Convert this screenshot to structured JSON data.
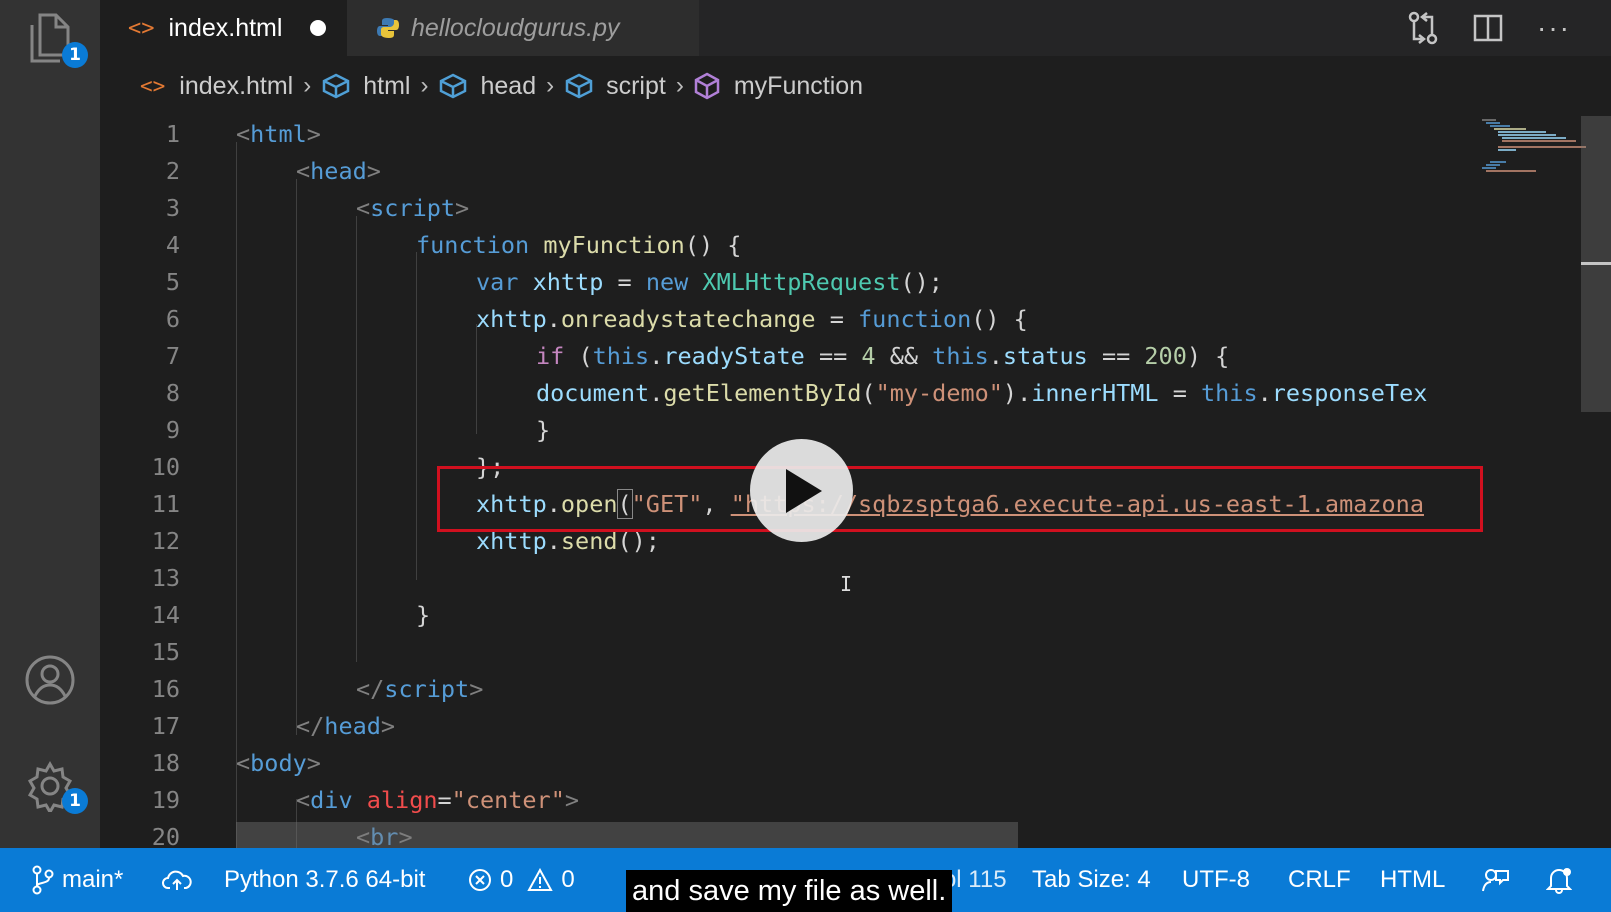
{
  "tabs": [
    {
      "label": "index.html",
      "active": true,
      "modified": true
    },
    {
      "label": "hellocloudgurus.py",
      "active": false
    }
  ],
  "activity_bar": {
    "explorer_badge": "1",
    "settings_badge": "1"
  },
  "breadcrumb": [
    "index.html",
    "html",
    "head",
    "script",
    "myFunction"
  ],
  "line_numbers": [
    "1",
    "2",
    "3",
    "4",
    "5",
    "6",
    "7",
    "8",
    "9",
    "10",
    "11",
    "12",
    "13",
    "14",
    "15",
    "16",
    "17",
    "18",
    "19",
    "20"
  ],
  "code_tokens": {
    "l1": [
      "<",
      "html",
      ">"
    ],
    "l2": [
      "<",
      "head",
      ">"
    ],
    "l3": [
      "<",
      "script",
      ">"
    ],
    "l4": [
      "function",
      " ",
      "myFunction",
      "() {"
    ],
    "l5": [
      "var",
      " ",
      "xhttp",
      " = ",
      "new",
      " ",
      "XMLHttpRequest",
      "();"
    ],
    "l6": [
      "xhttp",
      ".",
      "onreadystatechange",
      " = ",
      "function",
      "() {"
    ],
    "l7": [
      "if",
      " (",
      "this",
      ".",
      "readyState",
      " == ",
      "4",
      " && ",
      "this",
      ".",
      "status",
      " == ",
      "200",
      ") {"
    ],
    "l8": [
      "document",
      ".",
      "getElementById",
      "(",
      "\"my-demo\"",
      ").",
      "innerHTML",
      " = ",
      "this",
      ".",
      "responseTex"
    ],
    "l9": [
      "}"
    ],
    "l10": [
      "};"
    ],
    "l11": [
      "xhttp",
      ".",
      "open",
      "(",
      "\"GET\"",
      ", ",
      "\"https://sqbzsptga6.execute-api.us-east-1.amazona"
    ],
    "l12": [
      "xhttp",
      ".",
      "send",
      "();"
    ],
    "l14": [
      "}"
    ],
    "l16": [
      "</",
      "script",
      ">"
    ],
    "l17": [
      "</",
      "head",
      ">"
    ],
    "l18": [
      "<",
      "body",
      ">"
    ],
    "l19": [
      "<",
      "div",
      " ",
      "align",
      "=",
      "\"center\"",
      ">"
    ],
    "l20": [
      "<",
      "br",
      ">"
    ]
  },
  "statusbar": {
    "branch": "main*",
    "python": "Python 3.7.6 64-bit",
    "errors": "0",
    "warnings": "0",
    "cursor": "Ln 11, Col 115",
    "tab_size": "Tab Size: 4",
    "encoding": "UTF-8",
    "eol": "CRLF",
    "language": "HTML"
  },
  "caption": "and save my file as well.",
  "colors": {
    "accent": "#0a7bd6",
    "highlight_box": "#d1101f"
  }
}
